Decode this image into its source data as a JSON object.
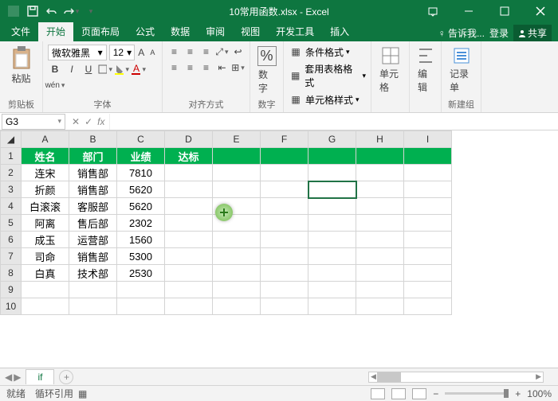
{
  "app": {
    "title": "10常用函数.xlsx - Excel"
  },
  "tabs": {
    "file": "文件",
    "home": "开始",
    "layout": "页面布局",
    "formula": "公式",
    "data": "数据",
    "review": "审阅",
    "view": "视图",
    "dev": "开发工具",
    "insert": "插入",
    "tell": "告诉我...",
    "login": "登录",
    "share": "共享"
  },
  "ribbon": {
    "clipboard": {
      "paste": "粘贴",
      "label": "剪贴板"
    },
    "font": {
      "name": "微软雅黑",
      "size": "12",
      "label": "字体"
    },
    "align": {
      "label": "对齐方式"
    },
    "number": {
      "btn": "数字",
      "label": "数字"
    },
    "styles": {
      "cond": "条件格式",
      "table": "套用表格格式",
      "cell": "单元格样式"
    },
    "cells": {
      "btn": "单元格"
    },
    "edit": {
      "btn": "编辑"
    },
    "record": {
      "btn": "记录单",
      "label": "新建组"
    }
  },
  "namebox": {
    "ref": "G3"
  },
  "headers": [
    "姓名",
    "部门",
    "业绩",
    "达标"
  ],
  "rows": [
    {
      "name": "连宋",
      "dept": "销售部",
      "score": "7810"
    },
    {
      "name": "折颜",
      "dept": "销售部",
      "score": "5620"
    },
    {
      "name": "白滚滚",
      "dept": "客服部",
      "score": "5620"
    },
    {
      "name": "阿离",
      "dept": "售后部",
      "score": "2302"
    },
    {
      "name": "成玉",
      "dept": "运营部",
      "score": "1560"
    },
    {
      "name": "司命",
      "dept": "销售部",
      "score": "5300"
    },
    {
      "name": "白真",
      "dept": "技术部",
      "score": "2530"
    }
  ],
  "sheet": {
    "name": "if"
  },
  "status": {
    "ready": "就绪",
    "circ": "循环引用",
    "zoom": "100%"
  }
}
